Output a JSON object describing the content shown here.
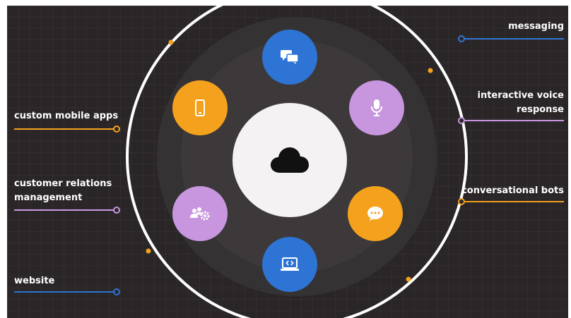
{
  "labels": {
    "custom_mobile_apps": "custom mobile apps",
    "crm_line1": "customer relations",
    "crm_line2": "management",
    "website": "website",
    "messaging": "messaging",
    "ivr_line1": "interactive voice",
    "ivr_line2": "response",
    "conversational_bots": "conversational bots"
  },
  "icons": {
    "center": "cloud-icon",
    "top": "chat-bubbles-icon",
    "top_right": "microphone-icon",
    "right": "speech-bubble-icon",
    "bottom": "laptop-code-icon",
    "left": "people-gear-icon",
    "top_left": "mobile-phone-icon"
  },
  "colors": {
    "background": "#2a2627",
    "blue": "#2e74d4",
    "orange": "#f4a11e",
    "purple": "#c896df",
    "ring": "#ffffff",
    "center": "#f4f2f2"
  }
}
